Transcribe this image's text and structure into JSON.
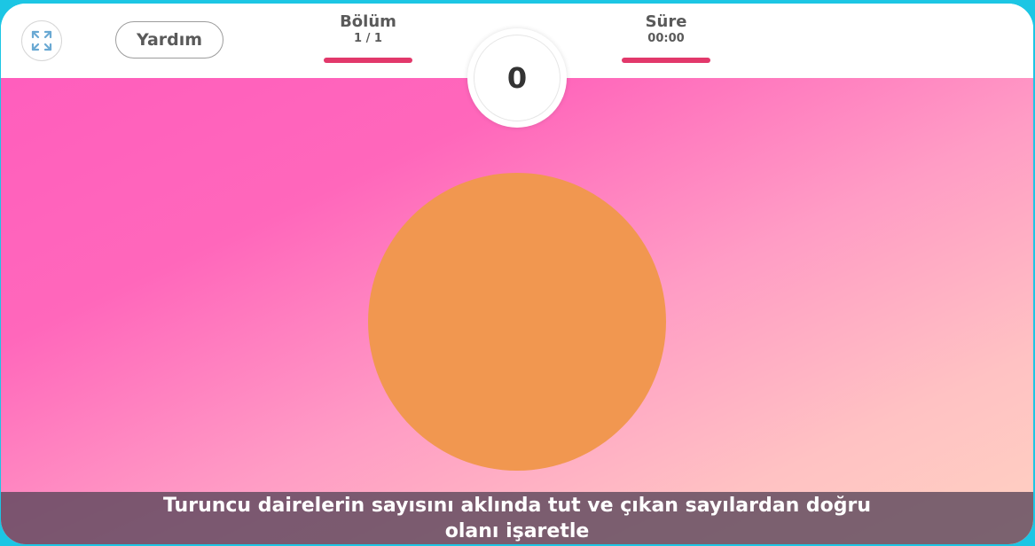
{
  "header": {
    "help_label": "Yardım",
    "level": {
      "label": "Bölüm",
      "value": "1 / 1"
    },
    "time": {
      "label": "Süre",
      "value": "00:00"
    },
    "accent_color": "#e2386b"
  },
  "score": {
    "value": "0"
  },
  "game": {
    "target_color": "#f19750",
    "instruction": "Turuncu dairelerin sayısını aklında tut ve çıkan sayılardan doğru olanı işaretle"
  },
  "icons": {
    "fullscreen": "fullscreen-expand-icon"
  }
}
